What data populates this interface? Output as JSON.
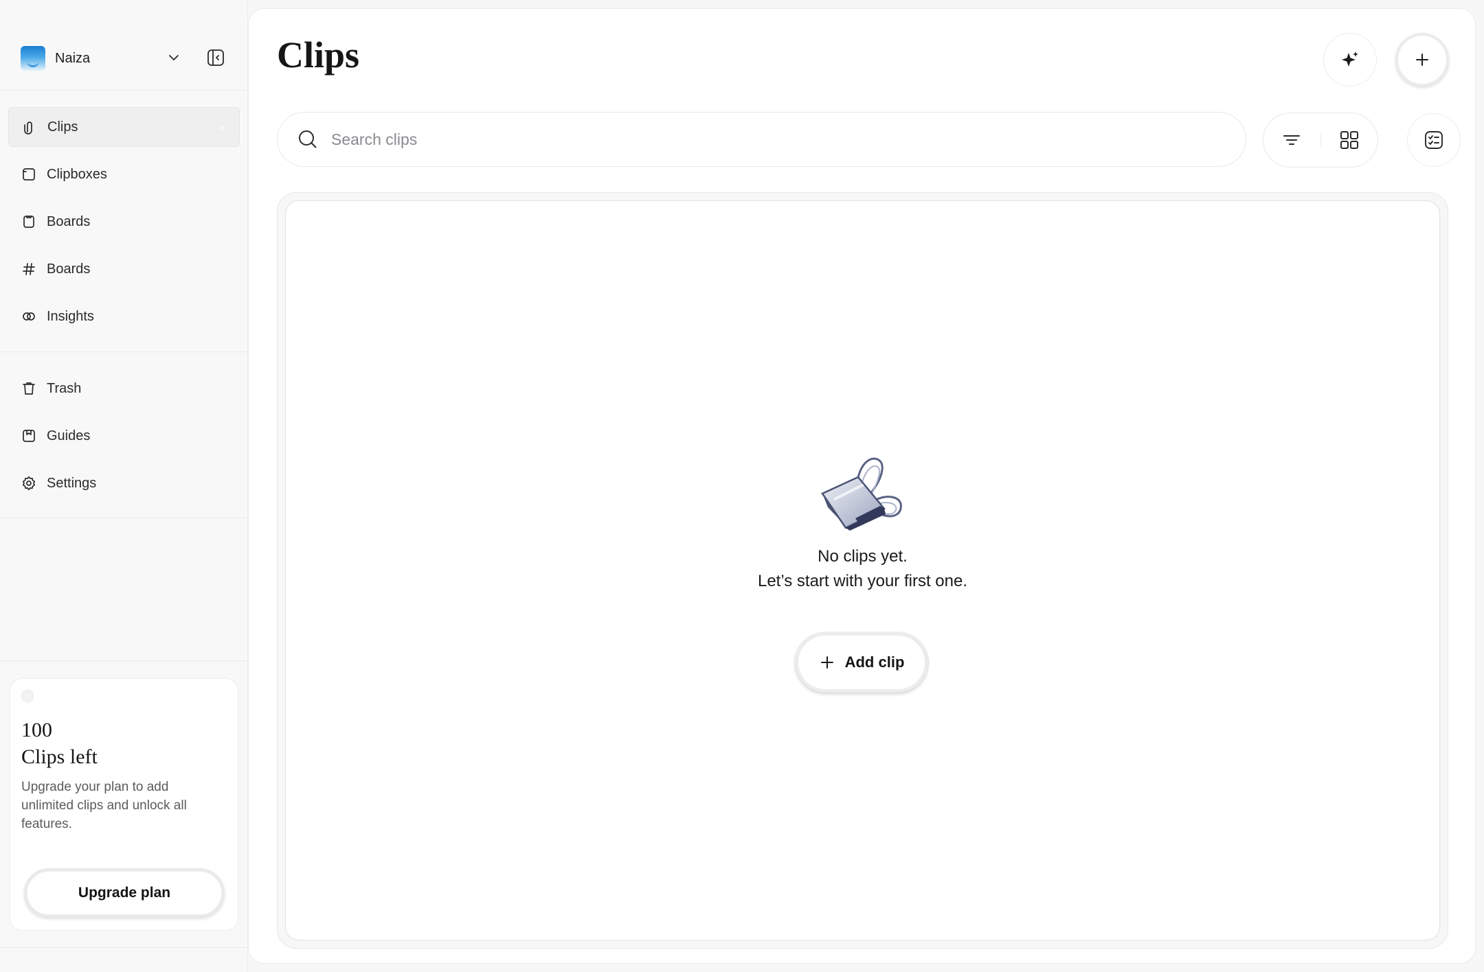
{
  "sidebar": {
    "workspace": {
      "name": "Naiza"
    },
    "nav": [
      {
        "label": "Clips",
        "icon": "paperclip-icon",
        "active": true
      },
      {
        "label": "Clipboxes",
        "icon": "box-icon"
      },
      {
        "label": "Boards",
        "icon": "board-icon"
      },
      {
        "label": "Boards",
        "icon": "hash-icon"
      },
      {
        "label": "Insights",
        "icon": "insights-icon"
      }
    ],
    "secondary_nav": [
      {
        "label": "Trash",
        "icon": "trash-icon"
      },
      {
        "label": "Guides",
        "icon": "book-icon"
      },
      {
        "label": "Settings",
        "icon": "gear-icon"
      }
    ],
    "upgrade_card": {
      "count": "100",
      "title": "Clips left",
      "description": "Upgrade your plan to add unlimited clips and unlock all features.",
      "button_label": "Upgrade plan"
    }
  },
  "header": {
    "title": "Clips"
  },
  "search": {
    "placeholder": "Search clips",
    "value": ""
  },
  "empty_state": {
    "title": "No clips yet.",
    "subtitle": "Let’s start with your first one.",
    "button_label": "Add clip"
  }
}
